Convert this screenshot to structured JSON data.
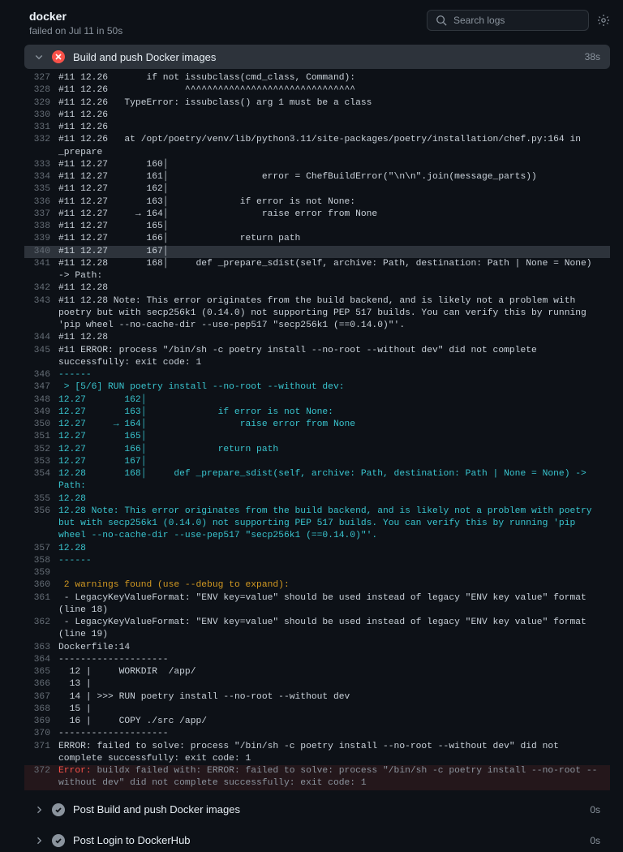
{
  "header": {
    "title": "docker",
    "subtitle": "failed on Jul 11 in 50s",
    "search_placeholder": "Search logs"
  },
  "main_step": {
    "title": "Build and push Docker images",
    "duration": "38s"
  },
  "log_lines": [
    {
      "n": "327",
      "c": "#11 12.26       if not issubclass(cmd_class, Command):"
    },
    {
      "n": "328",
      "c": "#11 12.26              ^^^^^^^^^^^^^^^^^^^^^^^^^^^^^^^"
    },
    {
      "n": "329",
      "c": "#11 12.26   TypeError: issubclass() arg 1 must be a class"
    },
    {
      "n": "330",
      "c": "#11 12.26"
    },
    {
      "n": "331",
      "c": "#11 12.26"
    },
    {
      "n": "332",
      "c": "#11 12.26   at /opt/poetry/venv/lib/python3.11/site-packages/poetry/installation/chef.py:164 in _prepare"
    },
    {
      "n": "333",
      "c": "#11 12.27       160│ "
    },
    {
      "n": "334",
      "c": "#11 12.27       161│                 error = ChefBuildError(\"\\n\\n\".join(message_parts))"
    },
    {
      "n": "335",
      "c": "#11 12.27       162│ "
    },
    {
      "n": "336",
      "c": "#11 12.27       163│             if error is not None:"
    },
    {
      "n": "337",
      "c": "#11 12.27     → 164│                 raise error from None"
    },
    {
      "n": "338",
      "c": "#11 12.27       165│ "
    },
    {
      "n": "339",
      "c": "#11 12.27       166│             return path"
    },
    {
      "n": "340",
      "c": "#11 12.27       167│ ",
      "hl": true
    },
    {
      "n": "341",
      "c": "#11 12.28       168│     def _prepare_sdist(self, archive: Path, destination: Path | None = None) -> Path:"
    },
    {
      "n": "342",
      "c": "#11 12.28"
    },
    {
      "n": "343",
      "c": "#11 12.28 Note: This error originates from the build backend, and is likely not a problem with poetry but with secp256k1 (0.14.0) not supporting PEP 517 builds. You can verify this by running 'pip wheel --no-cache-dir --use-pep517 \"secp256k1 (==0.14.0)\"'."
    },
    {
      "n": "344",
      "c": "#11 12.28"
    },
    {
      "n": "345",
      "c": "#11 ERROR: process \"/bin/sh -c poetry install --no-root --without dev\" did not complete successfully: exit code: 1"
    },
    {
      "n": "346",
      "c": "------",
      "cls": "c-teal"
    },
    {
      "n": "347",
      "c": " > [5/6] RUN poetry install --no-root --without dev:",
      "cls": "c-teal"
    },
    {
      "n": "348",
      "c": "12.27       162│ ",
      "cls": "c-teal"
    },
    {
      "n": "349",
      "c": "12.27       163│             if error is not None:",
      "cls": "c-teal"
    },
    {
      "n": "350",
      "c": "12.27     → 164│                 raise error from None",
      "cls": "c-teal"
    },
    {
      "n": "351",
      "c": "12.27       165│ ",
      "cls": "c-teal"
    },
    {
      "n": "352",
      "c": "12.27       166│             return path",
      "cls": "c-teal"
    },
    {
      "n": "353",
      "c": "12.27       167│ ",
      "cls": "c-teal"
    },
    {
      "n": "354",
      "c": "12.28       168│     def _prepare_sdist(self, archive: Path, destination: Path | None = None) -> Path:",
      "cls": "c-teal"
    },
    {
      "n": "355",
      "c": "12.28",
      "cls": "c-teal"
    },
    {
      "n": "356",
      "c": "12.28 Note: This error originates from the build backend, and is likely not a problem with poetry but with secp256k1 (0.14.0) not supporting PEP 517 builds. You can verify this by running 'pip wheel --no-cache-dir --use-pep517 \"secp256k1 (==0.14.0)\"'.",
      "cls": "c-teal"
    },
    {
      "n": "357",
      "c": "12.28",
      "cls": "c-teal"
    },
    {
      "n": "358",
      "c": "------",
      "cls": "c-teal"
    },
    {
      "n": "359",
      "c": ""
    },
    {
      "n": "360",
      "c": " 2 warnings found (use --debug to expand):",
      "cls": "c-yellow"
    },
    {
      "n": "361",
      "c": " - LegacyKeyValueFormat: \"ENV key=value\" should be used instead of legacy \"ENV key value\" format (line 18)"
    },
    {
      "n": "362",
      "c": " - LegacyKeyValueFormat: \"ENV key=value\" should be used instead of legacy \"ENV key value\" format (line 19)"
    },
    {
      "n": "363",
      "c": "Dockerfile:14"
    },
    {
      "n": "364",
      "c": "--------------------"
    },
    {
      "n": "365",
      "c": "  12 |     WORKDIR  /app/"
    },
    {
      "n": "366",
      "c": "  13 | "
    },
    {
      "n": "367",
      "c": "  14 | >>> RUN poetry install --no-root --without dev"
    },
    {
      "n": "368",
      "c": "  15 | "
    },
    {
      "n": "369",
      "c": "  16 |     COPY ./src /app/"
    },
    {
      "n": "370",
      "c": "--------------------"
    },
    {
      "n": "371",
      "c": "ERROR: failed to solve: process \"/bin/sh -c poetry install --no-root --without dev\" did not complete successfully: exit code: 1"
    },
    {
      "n": "372",
      "err": true,
      "prefix": "Error: ",
      "c": "buildx failed with: ERROR: failed to solve: process \"/bin/sh -c poetry install --no-root --without dev\" did not complete successfully: exit code: 1"
    }
  ],
  "sub_steps": [
    {
      "title": "Post Build and push Docker images",
      "duration": "0s"
    },
    {
      "title": "Post Login to DockerHub",
      "duration": "0s"
    }
  ]
}
